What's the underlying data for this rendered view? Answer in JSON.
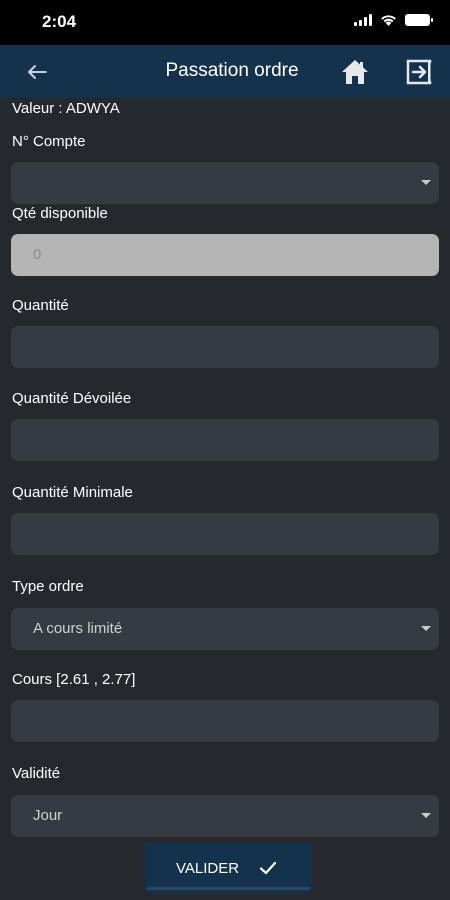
{
  "status_bar": {
    "time": "2:04"
  },
  "app_bar": {
    "title": "Passation ordre"
  },
  "form": {
    "valeur": "Valeur : ADWYA",
    "compte_label": "N° Compte",
    "compte_value": "",
    "qte_disponible_label": "Qté disponible",
    "qte_disponible_value": "0",
    "quantite_label": "Quantité",
    "quantite_value": "",
    "quantite_devoilee_label": "Quantité Dévoilée",
    "quantite_devoilee_value": "",
    "quantite_minimale_label": "Quantité Minimale",
    "quantite_minimale_value": "",
    "type_ordre_label": "Type ordre",
    "type_ordre_value": "A cours limité",
    "cours_label": "Cours [2.61 , 2.77]",
    "cours_value": "",
    "validite_label": "Validité",
    "validite_value": "Jour"
  },
  "actions": {
    "valider_label": "VALIDER"
  },
  "colors": {
    "background": "#25282d",
    "app_bar": "#15324d",
    "field": "#363a41",
    "field_disabled": "#b4b4b4"
  }
}
